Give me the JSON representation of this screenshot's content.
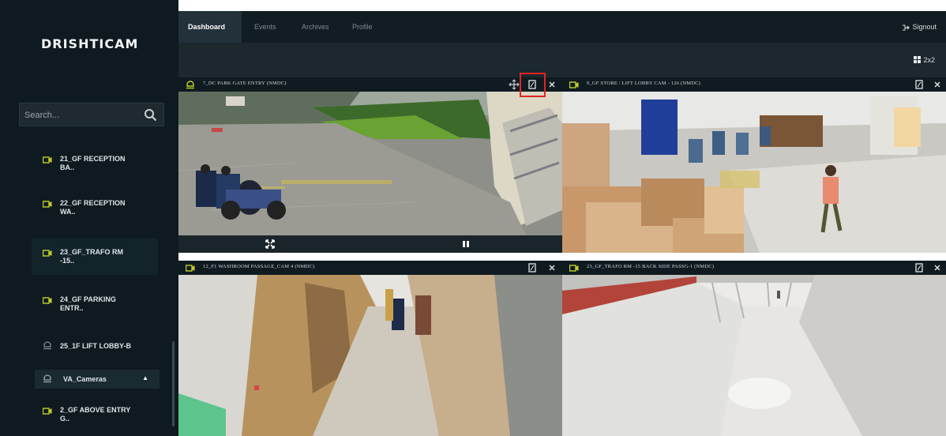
{
  "app": {
    "logo": "DRISHTICAM"
  },
  "nav": {
    "tabs": [
      "Dashboard",
      "Events",
      "Archives",
      "Profile"
    ],
    "signout": "Signout"
  },
  "layout": {
    "label": "2x2"
  },
  "search": {
    "placeholder": "Search..."
  },
  "sidebar": {
    "items": [
      {
        "l1": "21_GF RECEPTION",
        "l2": "BA.."
      },
      {
        "l1": "22_GF RECEPTION",
        "l2": "WA.."
      },
      {
        "l1": "23_GF_TRAFO RM",
        "l2": "-15.."
      },
      {
        "l1": "24_GF PARKING",
        "l2": "ENTR.."
      },
      {
        "l1": "25_1F LIFT LOBBY-B"
      },
      {
        "l1": "VA_Cameras"
      },
      {
        "l1": "2_GF ABOVE ENTRY",
        "l2": "G.."
      }
    ]
  },
  "tiles": [
    {
      "title": "7_DC PARK GATE ENTRY (NMDC)"
    },
    {
      "title": "9_GF STORE / LIFT LOBBY CAM - 126 (NMDC)"
    },
    {
      "title": "12_F1 WASHROOM PASSAGE_CAM 4 (NMDC)"
    },
    {
      "title": "23_GF_TRAFO RM -15 BACK SIDE PASSG-1 (NMDC)"
    }
  ],
  "colors": {
    "accent": "#c6d12a",
    "highlight": "#e0261f",
    "sidebar_bg": "#0e1a20"
  }
}
